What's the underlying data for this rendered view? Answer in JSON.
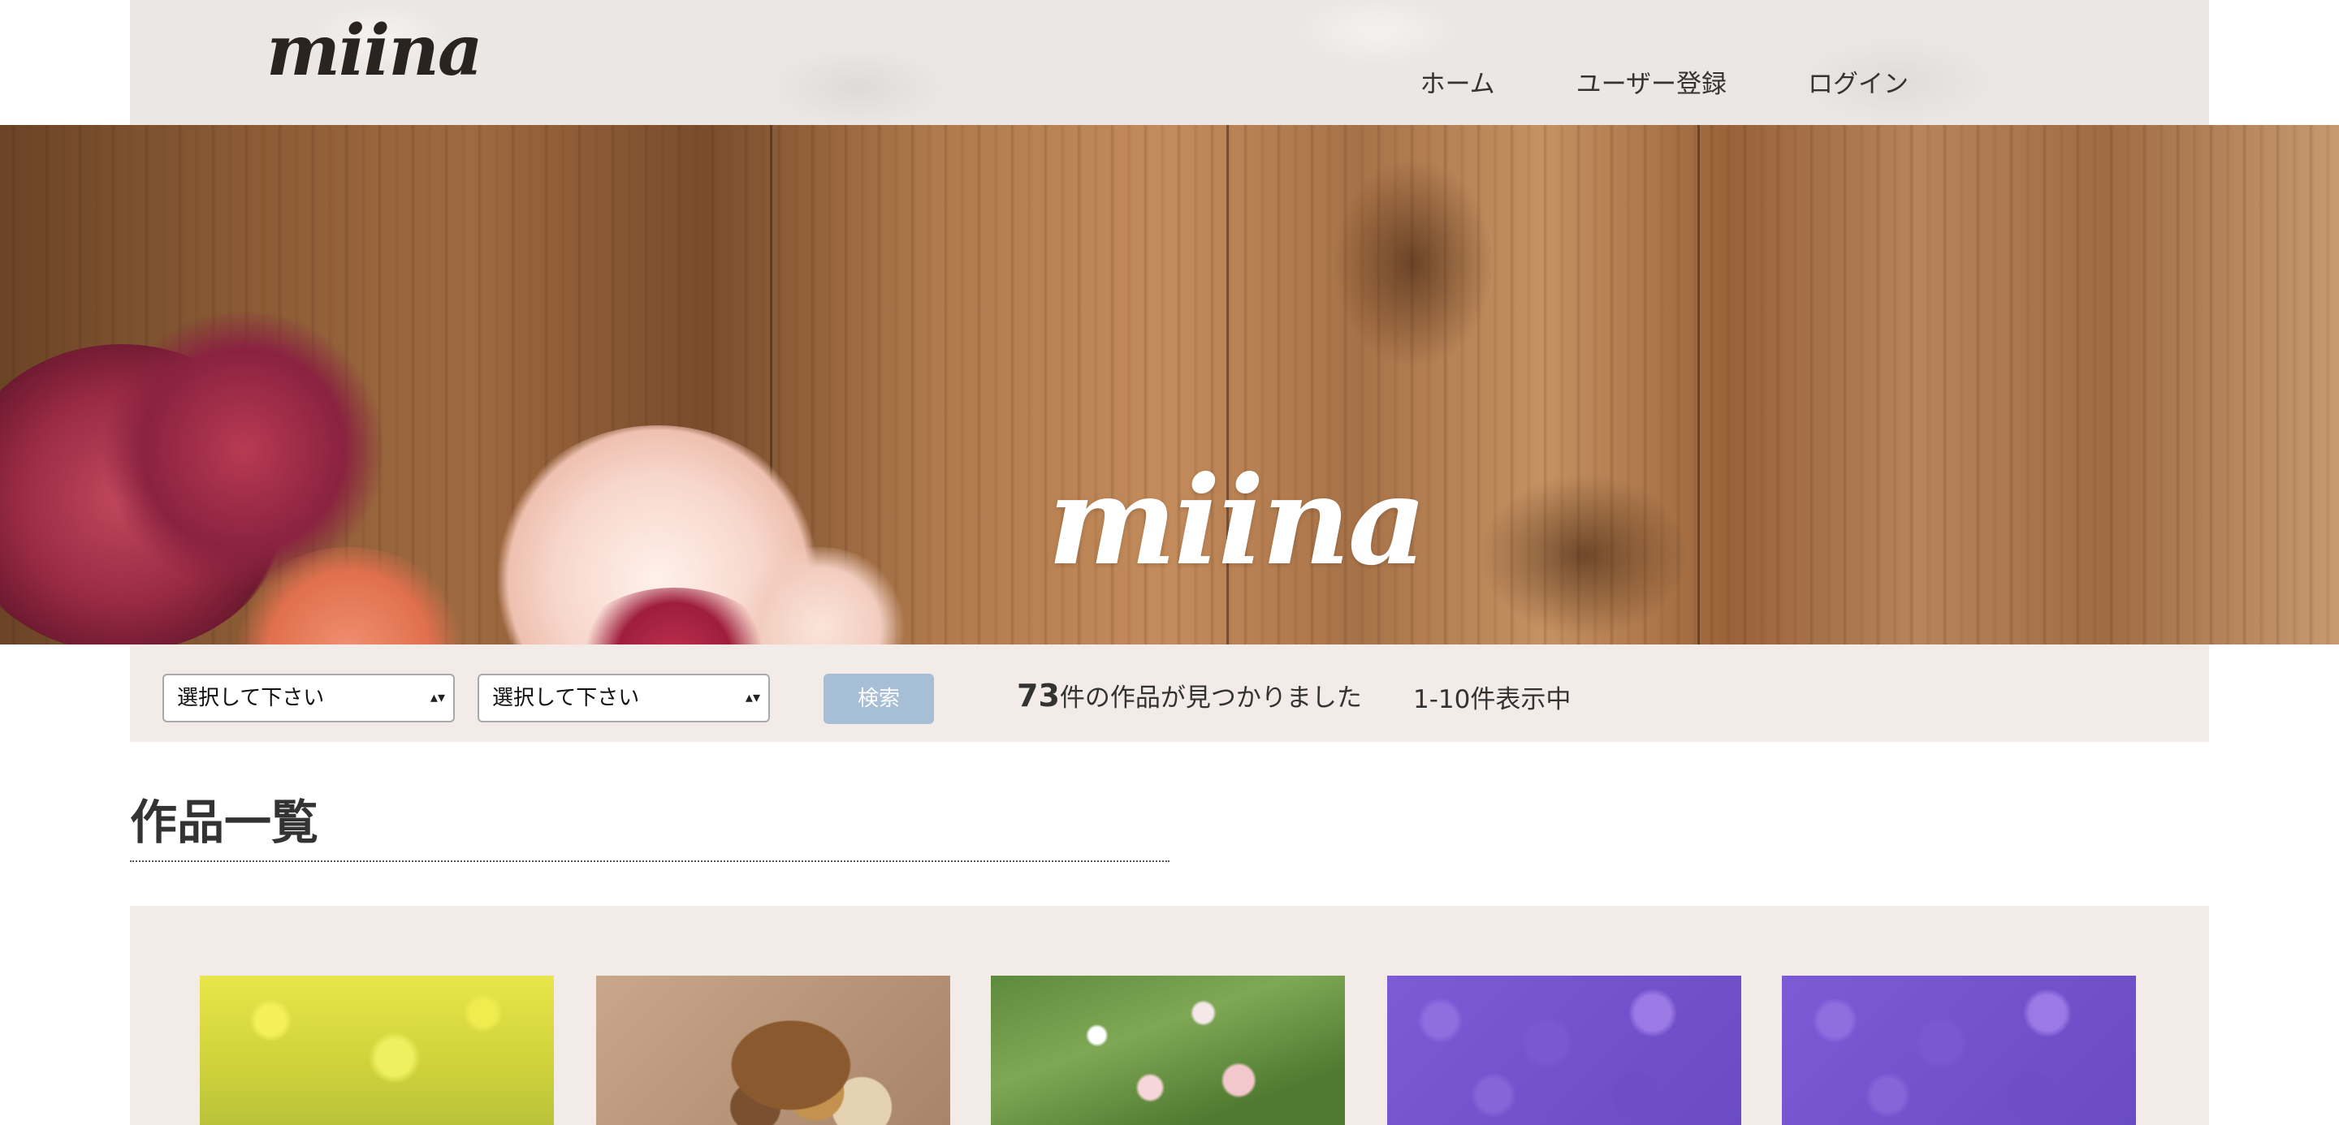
{
  "header": {
    "logo_text": "miina",
    "nav": [
      {
        "label": "ホーム"
      },
      {
        "label": "ユーザー登録"
      },
      {
        "label": "ログイン"
      }
    ]
  },
  "hero": {
    "logo_text": "miina"
  },
  "search": {
    "select1": {
      "selected": "選択して下さい"
    },
    "select2": {
      "selected": "選択して下さい"
    },
    "button_label": "検索",
    "result_count": "73",
    "result_suffix": "件の作品が見つかりました",
    "result_range": "1-10件表示中"
  },
  "main": {
    "section_title": "作品一覧",
    "items": [
      {
        "thumb": "rapeseed-field"
      },
      {
        "thumb": "basket-arrangement"
      },
      {
        "thumb": "garden-flowers"
      },
      {
        "thumb": "hydrangea"
      },
      {
        "thumb": "hydrangea"
      }
    ]
  },
  "colors": {
    "header_bg": "#ebe7e5",
    "bar_bg": "#f3ebe8",
    "button_bg": "#a6bed6"
  }
}
